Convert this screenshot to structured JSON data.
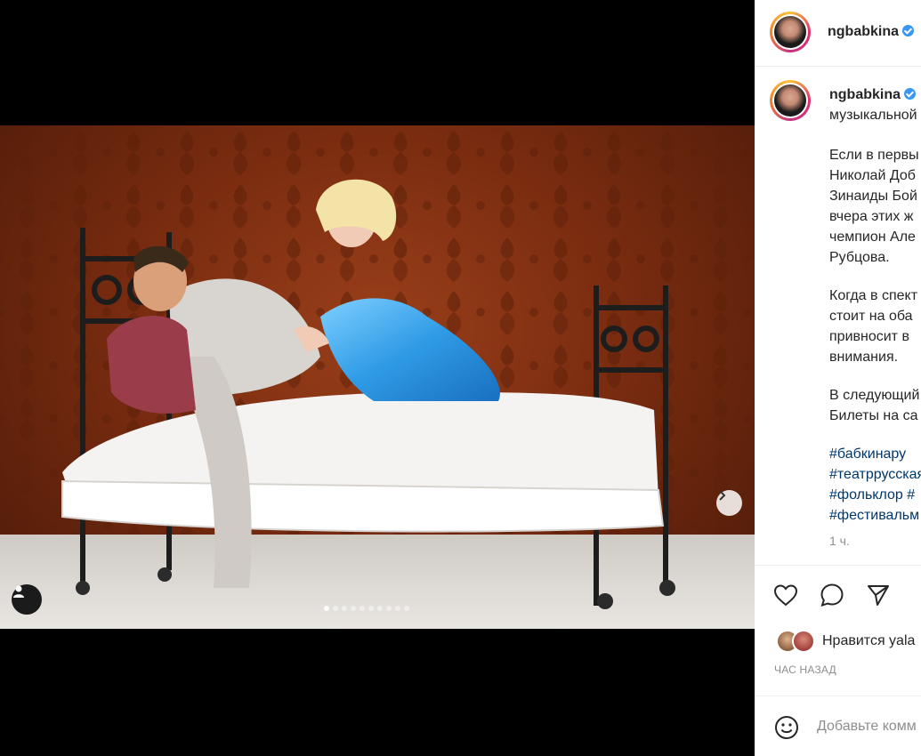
{
  "post": {
    "username": "ngbabkina",
    "caption_username": "ngbabkina",
    "caption_lines": [
      "музыкальной",
      "",
      "Если в первы",
      "Николай Доб",
      "Зинаиды Бой",
      "вчера этих ж",
      "чемпион Але",
      "Рубцова.",
      "",
      "Когда в спект",
      "стоит на оба",
      "привносит в",
      "внимания.",
      "",
      "В следующий",
      "Билеты на са"
    ],
    "hashtags": [
      "#бабкинару",
      "#театррусская",
      "#фольклор #",
      "#фестивальм"
    ],
    "time_since": "1 ч.",
    "likes_text": "Нравится yala",
    "ago_label": "ЧАС НАЗАД",
    "comment_placeholder": "Добавьте комм"
  },
  "carousel": {
    "total": 10,
    "current": 1
  },
  "icons": {
    "next": "chevron-right-icon",
    "tag": "user-tag-icon",
    "like": "heart-icon",
    "comment": "comment-icon",
    "share": "send-icon",
    "emoji": "emoji-icon",
    "verified": "verified-badge-icon"
  },
  "colors": {
    "hashtag": "#00376b",
    "verified": "#3897f0",
    "secondary_text": "#8e8e8e"
  }
}
